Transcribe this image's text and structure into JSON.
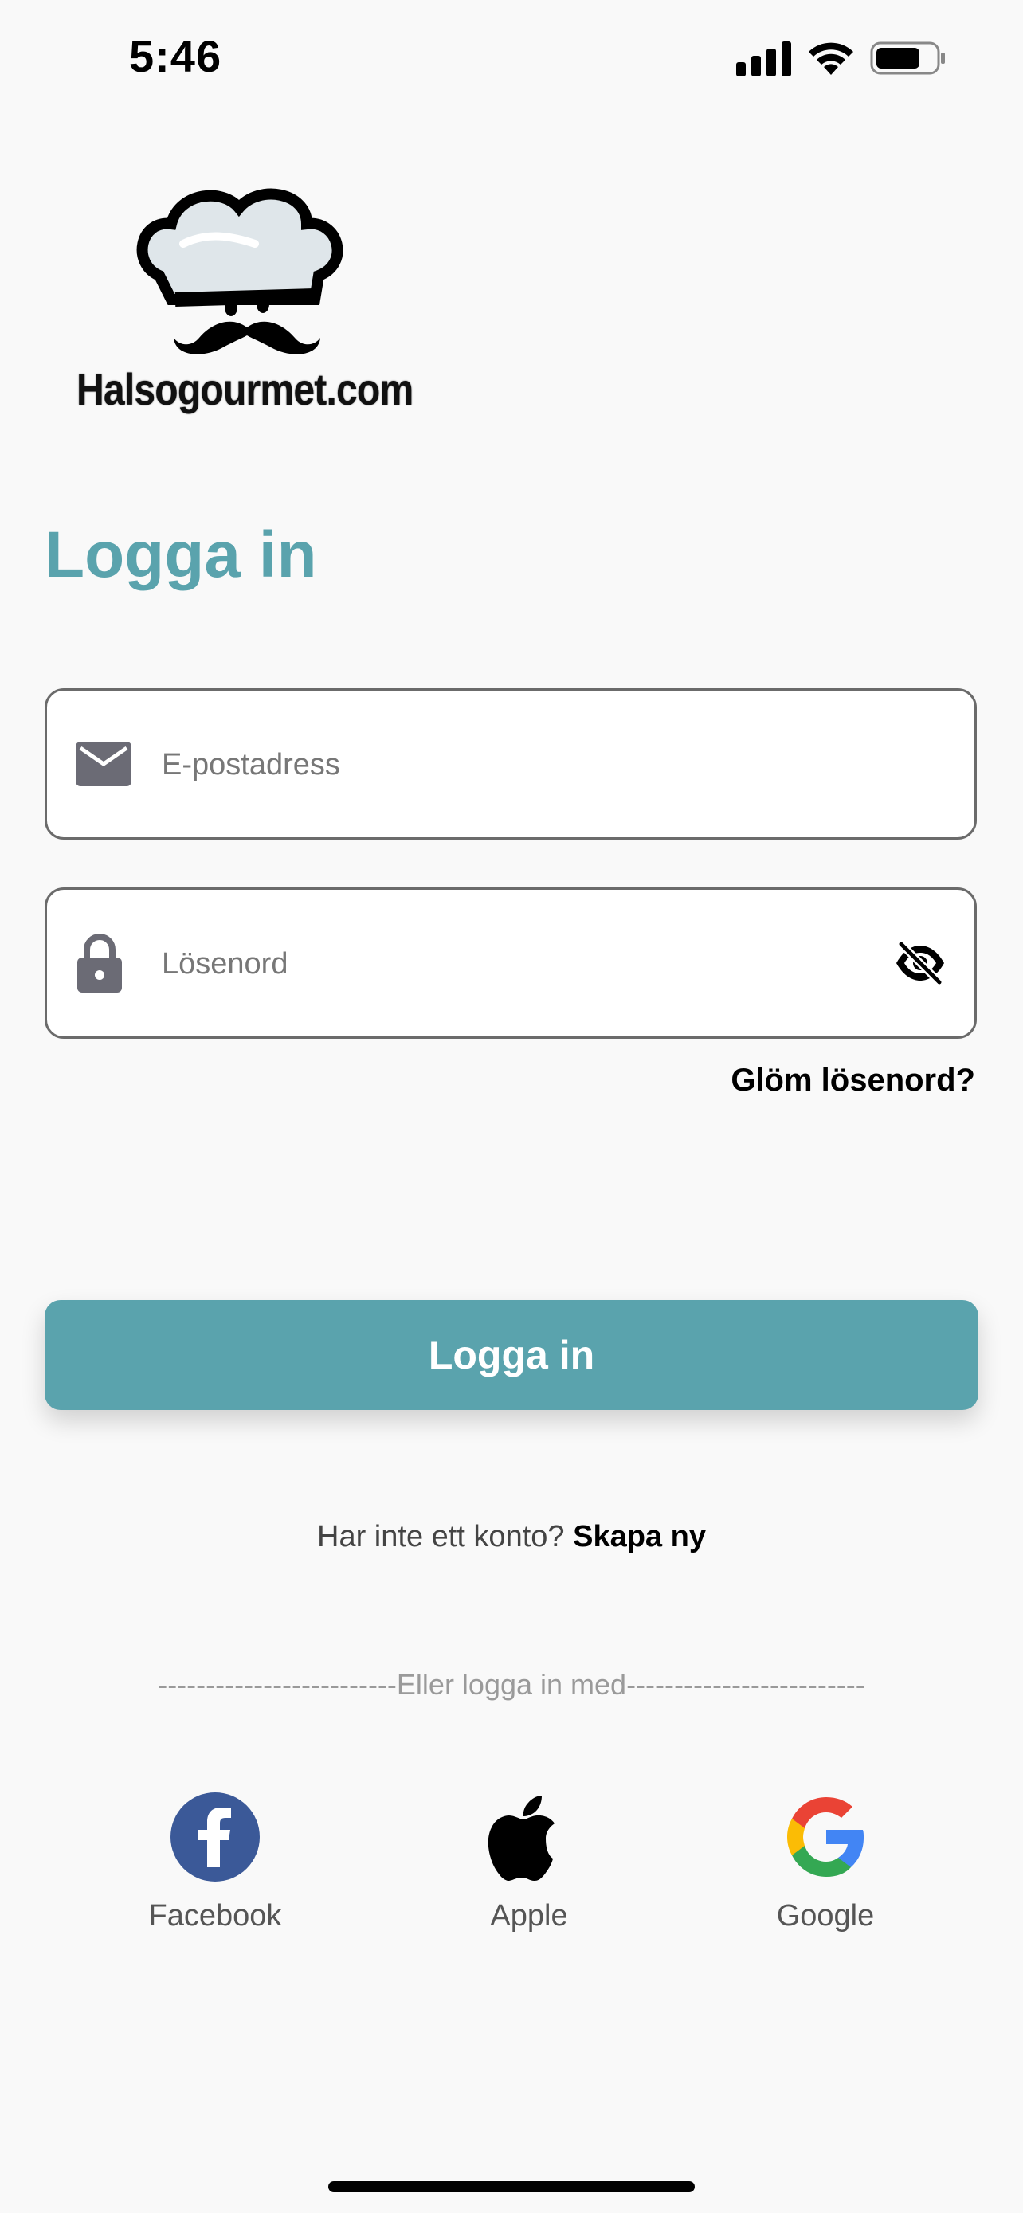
{
  "status_bar": {
    "time": "5:46"
  },
  "logo": {
    "text": "Halsogourmet.com"
  },
  "title": "Logga in",
  "email": {
    "placeholder": "E-postadress",
    "value": ""
  },
  "password": {
    "placeholder": "Lösenord",
    "value": ""
  },
  "forgot_password": "Glöm lösenord?",
  "login_button": "Logga in",
  "signup": {
    "prompt": "Har inte ett konto?",
    "link": "Skapa ny"
  },
  "divider": "-------------------------Eller logga in med-------------------------",
  "social": [
    {
      "label": "Facebook",
      "icon": "facebook-icon"
    },
    {
      "label": "Apple",
      "icon": "apple-icon"
    },
    {
      "label": "Google",
      "icon": "google-icon"
    }
  ],
  "colors": {
    "accent": "#5aa3ad",
    "background": "#f9f9f9",
    "facebook": "#3b5998"
  }
}
